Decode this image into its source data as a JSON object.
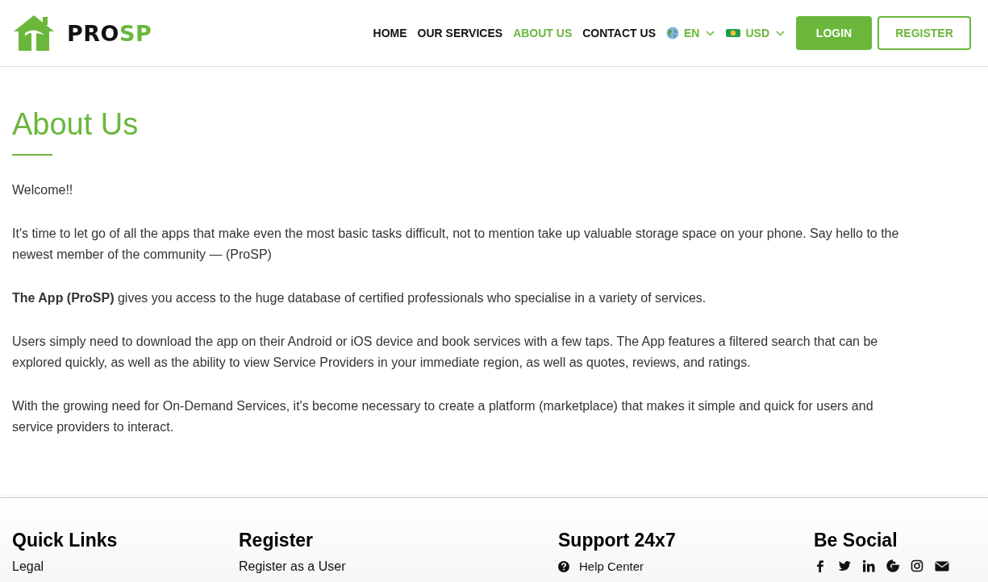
{
  "header": {
    "logo": {
      "part_1": "PRO",
      "part_2": "SP"
    },
    "nav": [
      {
        "label": "HOME",
        "selected": false
      },
      {
        "label": "OUR SERVICES",
        "selected": false
      },
      {
        "label": "ABOUT US",
        "selected": true
      },
      {
        "label": "CONTACT US",
        "selected": false
      }
    ],
    "selectors": [
      {
        "kind": "language",
        "label": "EN"
      },
      {
        "kind": "currency",
        "label": "USD"
      }
    ],
    "buttons": [
      {
        "kind": "filled",
        "label": "LOGIN"
      },
      {
        "kind": "outline",
        "label": "REGISTER"
      }
    ]
  },
  "main": {
    "title": "About Us",
    "paragraphs": [
      "Welcome!!",
      "It's time to let go of all the apps that make even the most basic tasks difficult, not to mention take up valuable storage space on your phone. Say hello to the newest member of the community — (ProSP)",
      "**The App (ProSP)** gives you access to the huge database of certified professionals who specialise in a variety of services.",
      "Users simply need to download the app on their Android or iOS device and book services with a few taps. The App features a filtered search that can be explored quickly, as well as the ability to view Service Providers in your immediate region, as well as quotes, reviews, and ratings.",
      "With the growing need for On-Demand Services, it's become necessary to create a platform (marketplace) that makes it simple and quick for users and service providers to interact."
    ]
  },
  "footer": {
    "columns": [
      {
        "kind": "links",
        "heading": "Quick Links",
        "links": [
          "Legal"
        ]
      },
      {
        "kind": "links",
        "heading": "Register",
        "links": [
          "Register as a User"
        ]
      },
      {
        "kind": "support",
        "heading": "Support 24x7",
        "links": [
          "Help Center"
        ]
      },
      {
        "kind": "social",
        "heading": "Be Social"
      }
    ]
  }
}
